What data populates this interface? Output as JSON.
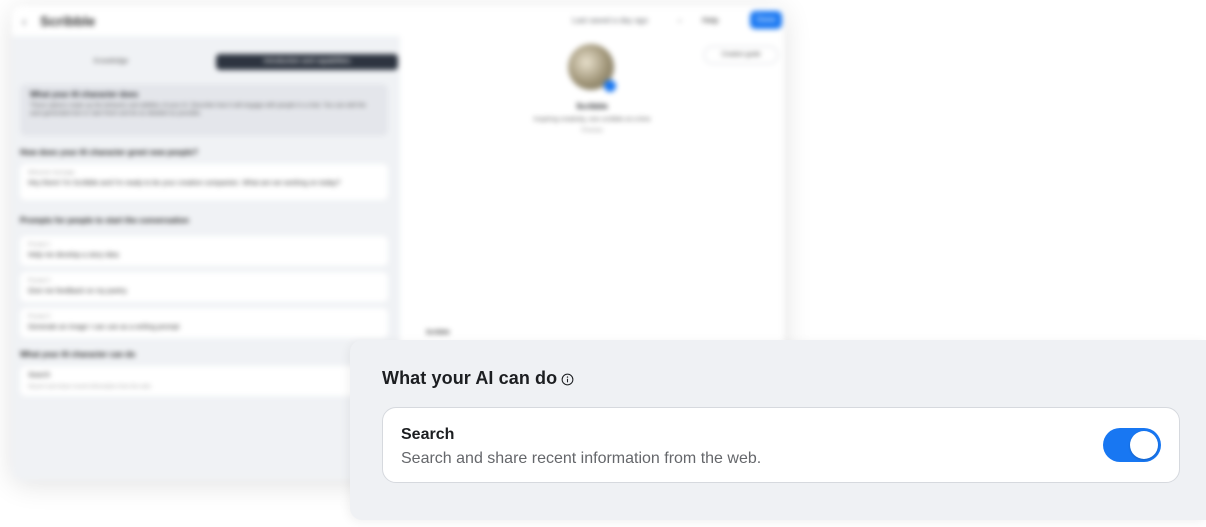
{
  "background": {
    "app_title": "Scribble",
    "topbar_hint": "Last saved a day ago",
    "help_label": "Help",
    "done_label": "Done",
    "tabs": [
      "Knowledge",
      "Introduction and capabilities"
    ],
    "info_heading": "What your AI character does",
    "info_text": "These options make up the behavior and abilities of your AI. Describe how it will engage with people in a chat. You can edit the auto-generated text or start fresh and be as detailed as possible.",
    "greeting_section": "How does your AI character greet new people?",
    "greeting_label": "Welcome message",
    "greeting_value": "Hey there! I'm Scribble and I'm ready to be your creative companion. What are we working on today?",
    "prompts_section": "Prompts for people to start the conversation",
    "prompts": [
      {
        "label": "Prompt 1",
        "value": "Help me develop a story idea"
      },
      {
        "label": "Prompt 2",
        "value": "Give me feedback on my poetry"
      },
      {
        "label": "Prompt 3",
        "value": "Generate an image I can use as a writing prompt"
      }
    ],
    "capabilities_section": "What your AI character can do",
    "capability_name": "Search",
    "capability_desc": "Search and share recent information from the web.",
    "preview_name": "Scribble",
    "preview_tagline": "Inspiring creativity, one scribble at a time",
    "preview_sub": "Preview",
    "guide_label": "Creation guide",
    "preview_msg_sender": "Scribble"
  },
  "overlay": {
    "title": "What your AI can do",
    "info_icon": "info-circle-icon",
    "skill": {
      "name": "Search",
      "description": "Search and share recent information from the web.",
      "enabled": true
    }
  },
  "colors": {
    "accent": "#1877f2",
    "panel_bg": "#eff1f4",
    "text_primary": "#1c1e21",
    "text_secondary": "#65676b"
  }
}
